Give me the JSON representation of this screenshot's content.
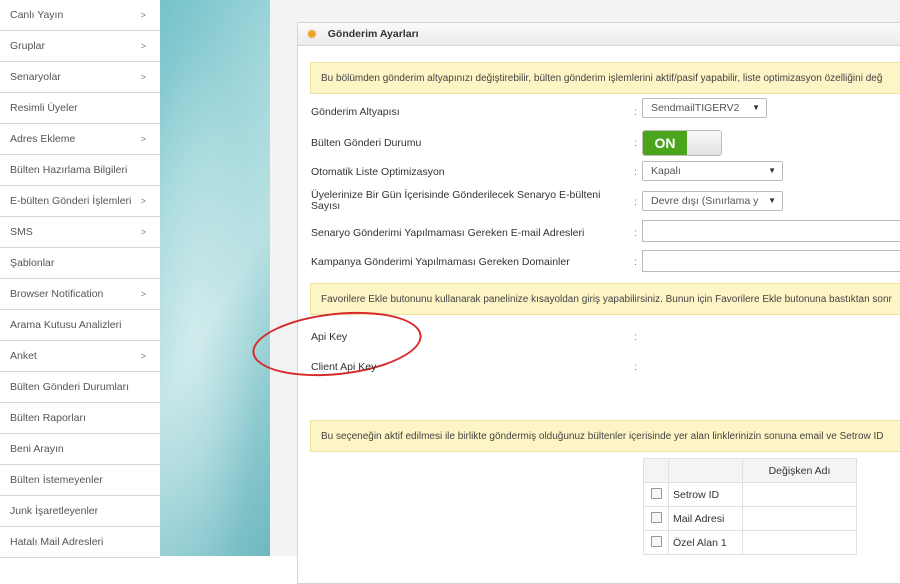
{
  "sidebar": {
    "items": [
      {
        "label": "Canlı Yayın",
        "arrow": true
      },
      {
        "label": "Gruplar",
        "arrow": true
      },
      {
        "label": "Senaryolar",
        "arrow": true
      },
      {
        "label": "Resimli Üyeler",
        "arrow": false
      },
      {
        "label": "Adres Ekleme",
        "arrow": true
      },
      {
        "label": "Bülten Hazırlama Bilgileri",
        "arrow": false
      },
      {
        "label": "E-bülten Gönderi İşlemleri",
        "arrow": true
      },
      {
        "label": "SMS",
        "arrow": true
      },
      {
        "label": "Şablonlar",
        "arrow": false
      },
      {
        "label": "Browser Notification",
        "arrow": true
      },
      {
        "label": "Arama Kutusu Analizleri",
        "arrow": false
      },
      {
        "label": "Anket",
        "arrow": true
      },
      {
        "label": "Bülten Gönderi Durumları",
        "arrow": false
      },
      {
        "label": "Bülten Raporları",
        "arrow": false
      },
      {
        "label": "Beni Arayın",
        "arrow": false
      },
      {
        "label": "Bülten İstemeyenler",
        "arrow": false
      },
      {
        "label": "Junk İşaretleyenler",
        "arrow": false
      },
      {
        "label": "Hatalı Mail Adresleri",
        "arrow": false
      }
    ],
    "chevron": ">"
  },
  "panel": {
    "title": "Gönderim Ayarları",
    "icon": "gear-icon",
    "note1": "Bu bölümden gönderim altyapınızı değiştirebilir, bülten gönderim işlemlerini aktif/pasif yapabilir, liste optimizasyon özelliğini değ",
    "note2": "Favorilere Ekle butonunu kullanarak panelinize kısayoldan giriş yapabilirsiniz. Bunun için Favorilere Ekle butonuna bastıktan sonr",
    "note3": "Bu seçeneğin aktif edilmesi ile birlikte göndermiş olduğunuz bültenler içerisinde yer alan linklerinizin sonuna email ve Setrow ID"
  },
  "fields": {
    "altyapi_label": "Gönderim Altyapısı",
    "altyapi_value": "SendmailTIGERV2",
    "durum_label": "Bülten Gönderi Durumu",
    "durum_value": "ON",
    "optimizasyon_label": "Otomatik Liste Optimizasyon",
    "optimizasyon_value": "Kapalı",
    "senaryo_label": "Üyelerinize Bir Gün İçerisinde Gönderilecek Senaryo E-bülteni Sayısı",
    "senaryo_value": "Devre dışı (Sınırlama y",
    "senaryo_email_label": "Senaryo Gönderimi Yapılmaması Gereken E-mail Adresleri",
    "kampanya_label": "Kampanya Gönderimi Yapılmaması Gereken Domainler",
    "api_key_label": "Api Key",
    "client_api_key_label": "Client Api Key",
    "colon": ":"
  },
  "table": {
    "header": "Değişken Adı",
    "rows": [
      "Setrow ID",
      "Mail Adresi",
      "Özel Alan 1"
    ]
  },
  "colors": {
    "toggle_on": "#4aa41c",
    "note_bg": "#fdf5c6",
    "annotation": "#d62b2b"
  }
}
